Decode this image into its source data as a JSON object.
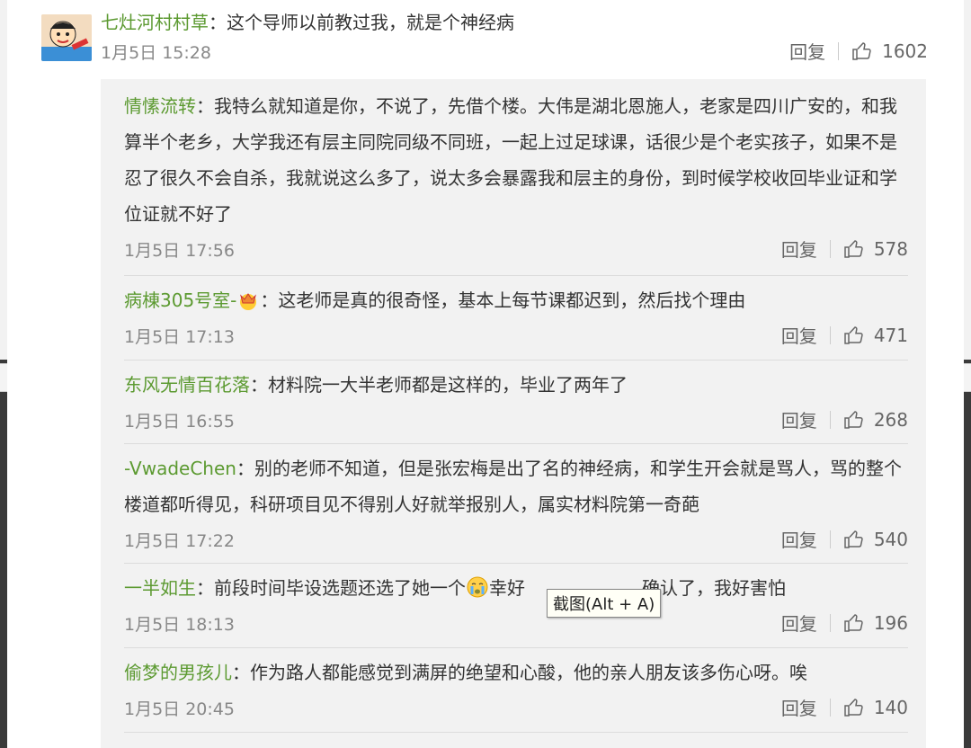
{
  "main_comment": {
    "user": "七灶河村村草",
    "text": "：这个导师以前教过我，就是个神经病",
    "time": "1月5日 15:28",
    "reply_label": "回复",
    "likes": "1602"
  },
  "replies": [
    {
      "user": "情愫流转",
      "text": "：我特么就知道是你，不说了，先借个楼。大伟是湖北恩施人，老家是四川广安的，和我算半个老乡，大学我还有层主同院同级不同班，一起上过足球课，话很少是个老实孩子，如果不是忍了很久不会自杀，我就说这么多了，说太多会暴露我和层主的身份，到时候学校收回毕业证和学位证就不好了",
      "time": "1月5日 17:56",
      "reply_label": "回复",
      "likes": "578"
    },
    {
      "user": "病棟305号室-",
      "text": "：这老师是真的很奇怪，基本上每节课都迟到，然后找个理由",
      "time": "1月5日 17:13",
      "reply_label": "回复",
      "likes": "471"
    },
    {
      "user": "东风无情百花落",
      "text": "：材料院一大半老师都是这样的，毕业了两年了",
      "time": "1月5日 16:55",
      "reply_label": "回复",
      "likes": "268"
    },
    {
      "user": "-VwadeChen",
      "text": "：别的老师不知道，但是张宏梅是出了名的神经病，和学生开会就是骂人，骂的整个楼道都听得见，科研项目见不得别人好就举报别人，属实材料院第一奇葩",
      "time": "1月5日 17:22",
      "reply_label": "回复",
      "likes": "540"
    },
    {
      "user": "一半如生",
      "text_a": "：前段时间毕设选题还选了她一个",
      "text_b": "幸好",
      "text_c": "确认了，我好害怕",
      "time": "1月5日 18:13",
      "reply_label": "回复",
      "likes": "196"
    },
    {
      "user": "偷梦的男孩儿",
      "text": "：作为路人都能感觉到满屏的绝望和心酸，他的亲人朋友该多伤心呀。唉",
      "time": "1月5日 20:45",
      "reply_label": "回复",
      "likes": "140"
    }
  ],
  "tooltip": "截图(Alt + A)",
  "colors": {
    "username": "#5c9a31",
    "text": "#333333",
    "meta": "#888888"
  },
  "icons": {
    "like": "thumbs-up-icon",
    "crown": "crown-emoji-icon",
    "crying": "crying-emoji-icon"
  }
}
